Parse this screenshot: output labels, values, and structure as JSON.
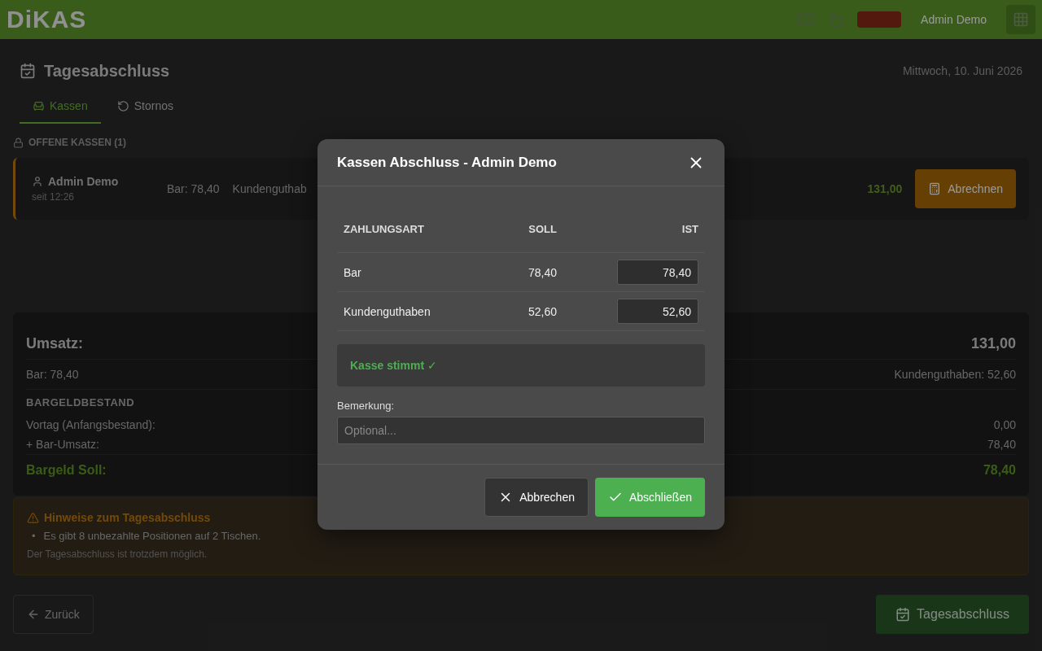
{
  "header": {
    "logo": "DiKAS",
    "user": "Admin Demo"
  },
  "page": {
    "title": "Tagesabschluss",
    "date": "Mittwoch, 10. Juni 2026"
  },
  "tabs": [
    {
      "label": "Kassen",
      "selected": true
    },
    {
      "label": "Stornos",
      "selected": false
    }
  ],
  "open_registers": {
    "heading": "OFFENE KASSEN (1)",
    "items": [
      {
        "user": "Admin Demo",
        "since": "seit 12:26",
        "amounts": [
          "Bar: 78,40",
          "Kundenguthab"
        ],
        "total": "131,00",
        "action": "Abrechnen"
      }
    ]
  },
  "summary": {
    "label": "Umsatz:",
    "total": "131,00",
    "left": "Bar: 78,40",
    "right": "Kundenguthaben: 52,60",
    "cash_heading": "BARGELDBESTAND",
    "rows": [
      {
        "label": "Vortag (Anfangsbestand):",
        "value": "0,00"
      },
      {
        "label": "+ Bar-Umsatz:",
        "value": "78,40"
      }
    ],
    "result_label": "Bargeld Soll:",
    "result_value": "78,40"
  },
  "notice": {
    "title": "Hinweise zum Tagesabschluss",
    "bullet": "•",
    "items": [
      "Es gibt 8 unbezahlte Positionen auf 2 Tischen."
    ],
    "footnote": "Der Tagesabschluss ist trotzdem möglich."
  },
  "footer": {
    "back": "Zurück",
    "submit": "Tagesabschluss",
    "submit_disabled": true
  },
  "dialog": {
    "title": "Kassen Abschluss - Admin Demo",
    "columns": [
      "ZAHLUNGSART",
      "SOLL",
      "IST"
    ],
    "rows": [
      {
        "method": "Bar",
        "expected": "78,40",
        "actual": "78,40"
      },
      {
        "method": "Kundenguthaben",
        "expected": "52,60",
        "actual": "52,60"
      }
    ],
    "status": "Kasse stimmt ✓",
    "remark_label": "Bemerkung:",
    "remark_placeholder": "Optional...",
    "cancel": "Abbrechen",
    "confirm": "Abschließen"
  }
}
